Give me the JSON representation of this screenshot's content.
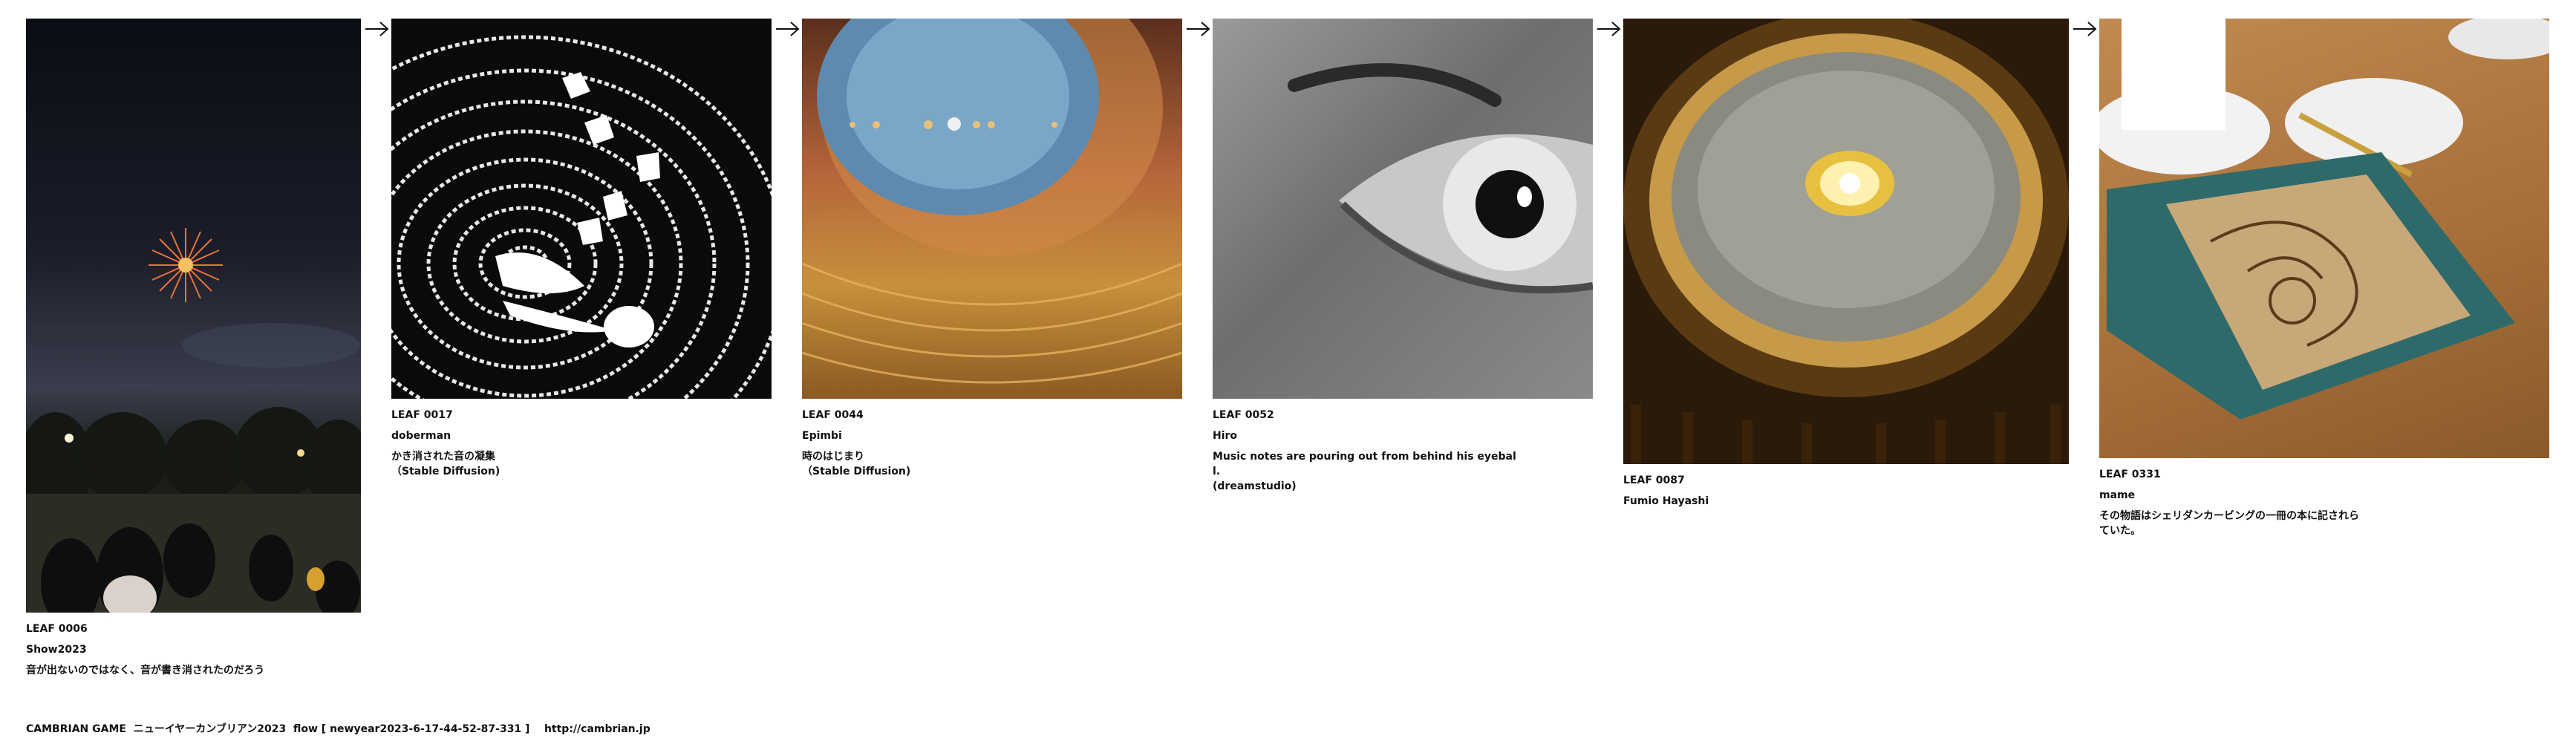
{
  "leaves": [
    {
      "id": "LEAF 0006",
      "author": "Show2023",
      "caption": "音が出ないのではなく、音が書き消されたのだろう",
      "image": "night-fireworks-crowd-photo"
    },
    {
      "id": "LEAF 0017",
      "author": "doberman",
      "caption": "かき消された音の凝集\n（Stable Diffusion)",
      "image": "black-white-ink-swirl-illustration"
    },
    {
      "id": "LEAF 0044",
      "author": "Epimbi",
      "caption": "時のはじまり\n（Stable Diffusion)",
      "image": "cosmic-eye-landscape-painting"
    },
    {
      "id": "LEAF 0052",
      "author": "Hiro",
      "caption": "Music notes are pouring out from behind his eyebal\nl.\n(dreamstudio)",
      "image": "grayscale-eye-closeup"
    },
    {
      "id": "LEAF 0087",
      "author": "Fumio Hayashi",
      "caption": "",
      "image": "opera-house-dome-ceiling"
    },
    {
      "id": "LEAF 0331",
      "author": "mame",
      "caption": "その物語はシェリダンカービングの一冊の本に記されら\nていた。",
      "image": "leather-carved-book-on-table"
    }
  ],
  "arrows": [
    "arrow-right-icon",
    "arrow-right-icon",
    "arrow-right-icon",
    "arrow-right-icon",
    "arrow-right-icon"
  ],
  "footer": {
    "text": "CAMBRIAN GAME  ニューイヤーカンブリアン2023  flow [ newyear2023-6-17-44-52-87-331 ]    http://cambrian.jp"
  }
}
